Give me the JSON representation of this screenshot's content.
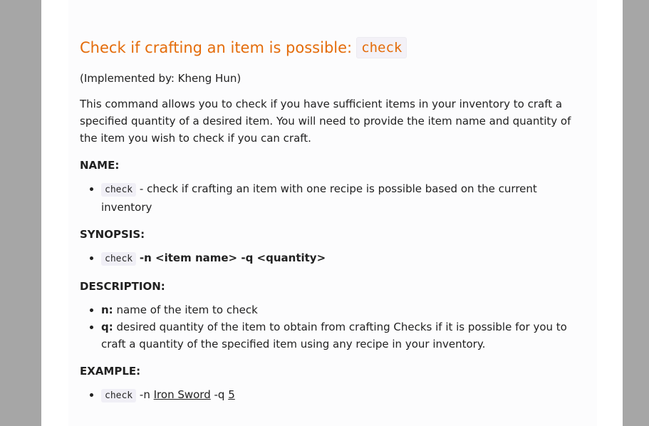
{
  "heading": {
    "text": "Check if crafting an item is possible:",
    "code": "check"
  },
  "implemented_by": "(Implemented by: Kheng Hun)",
  "description_paragraph": "This command allows you to check if you have sufficient items in your inventory to craft a specified quantity of a desired item. You will need to provide the item name and quantity of the item you wish to check if you can craft.",
  "sections": {
    "name": {
      "title": "NAME:",
      "code": "check",
      "text": " - check if crafting an item with one recipe is possible based on the current inventory"
    },
    "synopsis": {
      "title": "SYNOPSIS:",
      "code": "check",
      "args": "-n <item name> -q <quantity>"
    },
    "description": {
      "title": "DESCRIPTION:",
      "items": [
        {
          "flag": "n:",
          "text": "name of the item to check"
        },
        {
          "flag": "q:",
          "text": "desired quantity of the item to obtain from crafting Checks if it is possible for you to craft a quantity of the specified item using any recipe in your inventory."
        }
      ]
    },
    "example": {
      "title": "EXAMPLE:",
      "code": "check",
      "flag_n": "-n",
      "item": "Iron Sword",
      "flag_q": "-q",
      "quantity": "5"
    }
  }
}
